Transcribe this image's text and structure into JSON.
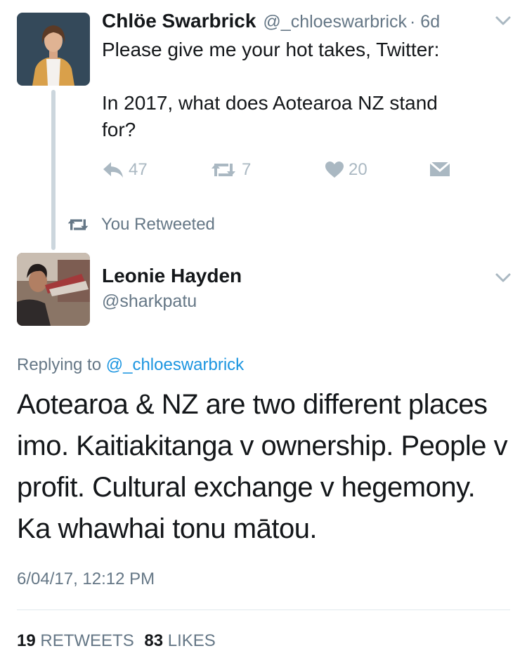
{
  "parent_tweet": {
    "author_name": "Chlöe Swarbrick",
    "handle": "@_chloeswarbrick",
    "time": "· 6d",
    "text_line1": "Please give me your hot takes, Twitter:",
    "text_line2": "In 2017, what does Aotearoa NZ stand",
    "text_line3": "for?",
    "replies": "47",
    "retweets": "7",
    "likes": "20"
  },
  "retweet_context": {
    "label": "You Retweeted"
  },
  "main_tweet": {
    "author_name": "Leonie Hayden",
    "handle": "@sharkpatu",
    "replying_prefix": "Replying to",
    "replying_handle": "@_chloeswarbrick",
    "text_lines": [
      "Aotearoa & NZ are two different places",
      "imo. Kaitiakitanga v ownership. People v",
      "profit. Cultural exchange v hegemony.",
      "Ka whawhai tonu mātou."
    ],
    "timestamp": "6/04/17, 12:12 PM",
    "retweet_count": "19",
    "retweet_label": "RETWEETS",
    "like_count": "83",
    "like_label": "LIKES"
  },
  "icons": {
    "reply": "reply-icon",
    "retweet": "retweet-icon",
    "like": "heart-icon",
    "dm": "envelope-icon",
    "caret": "chevron-down-icon"
  },
  "colors": {
    "text": "#14171a",
    "secondary": "#657786",
    "icon": "#aab8c2",
    "link": "#1b95e0"
  }
}
